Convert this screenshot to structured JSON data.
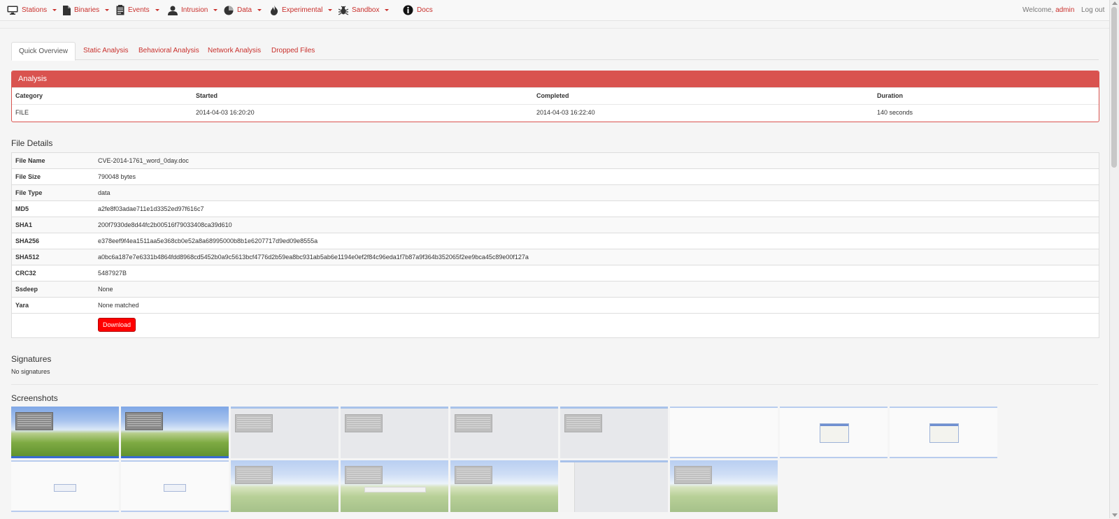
{
  "nav": {
    "items": [
      {
        "label": "Stations",
        "icon": "monitor-icon",
        "dropdown": true
      },
      {
        "label": "Binaries",
        "icon": "file-icon",
        "dropdown": true
      },
      {
        "label": "Events",
        "icon": "clipboard-icon",
        "dropdown": true
      },
      {
        "label": "Intrusion",
        "icon": "user-icon",
        "dropdown": true
      },
      {
        "label": "Data",
        "icon": "pie-chart-icon",
        "dropdown": true
      },
      {
        "label": "Experimental",
        "icon": "fire-icon",
        "dropdown": true
      },
      {
        "label": "Sandbox",
        "icon": "bug-icon",
        "dropdown": true
      },
      {
        "label": "Docs",
        "icon": "info-icon",
        "dropdown": false
      }
    ],
    "welcome": "Welcome,",
    "username": "admin",
    "logout": "Log out"
  },
  "tabs": [
    {
      "label": "Quick Overview",
      "active": true
    },
    {
      "label": "Static Analysis",
      "active": false
    },
    {
      "label": "Behavioral Analysis",
      "active": false
    },
    {
      "label": "Network Analysis",
      "active": false
    },
    {
      "label": "Dropped Files",
      "active": false
    }
  ],
  "analysis": {
    "title": "Analysis",
    "headers": {
      "category": "Category",
      "started": "Started",
      "completed": "Completed",
      "duration": "Duration"
    },
    "row": {
      "category": "FILE",
      "started": "2014-04-03 16:20:20",
      "completed": "2014-04-03 16:22:40",
      "duration": "140 seconds"
    }
  },
  "file_details": {
    "title": "File Details",
    "rows": [
      {
        "key": "File Name",
        "value": "CVE-2014-1761_word_0day.doc"
      },
      {
        "key": "File Size",
        "value": "790048 bytes"
      },
      {
        "key": "File Type",
        "value": "data"
      },
      {
        "key": "MD5",
        "value": "a2fe8f03adae711e1d3352ed97f616c7"
      },
      {
        "key": "SHA1",
        "value": "200f7930de8d44fc2b00516f79033408ca39d610"
      },
      {
        "key": "SHA256",
        "value": "e378eef9f4ea1511aa5e368cb0e52a8a68995000b8b1e6207717d9ed09e8555a"
      },
      {
        "key": "SHA512",
        "value": "a0bc6a187e7e6331b4864fdd8968cd5452b0a9c5613bcf4776d2b59ea8bc931ab5ab6e1194e0ef2f84c96eda1f7b87a9f364b352065f2ee9bca45c89e00f127a"
      },
      {
        "key": "CRC32",
        "value": "5487927B"
      },
      {
        "key": "Ssdeep",
        "value": "None"
      },
      {
        "key": "Yara",
        "value": "None matched"
      }
    ],
    "download_label": "Download"
  },
  "signatures": {
    "title": "Signatures",
    "empty_text": "No signatures"
  },
  "screenshots": {
    "title": "Screenshots",
    "thumbs": [
      "desktop-thumbnail",
      "desktop-thumbnail",
      "desktop-thumbnail",
      "desktop-thumbnail",
      "desktop-thumbnail",
      "desktop-thumbnail",
      "blank-thumbnail",
      "dialog-thumbnail",
      "dialog-thumbnail",
      "blank-thumbnail",
      "blank-thumbnail",
      "desktop-thumbnail",
      "desktop-thumbnail",
      "desktop-thumbnail",
      "window-thumbnail",
      "desktop-thumbnail"
    ]
  },
  "colors": {
    "accent": "#d9534f",
    "link": "#c9302c",
    "download": "#ff0000"
  }
}
